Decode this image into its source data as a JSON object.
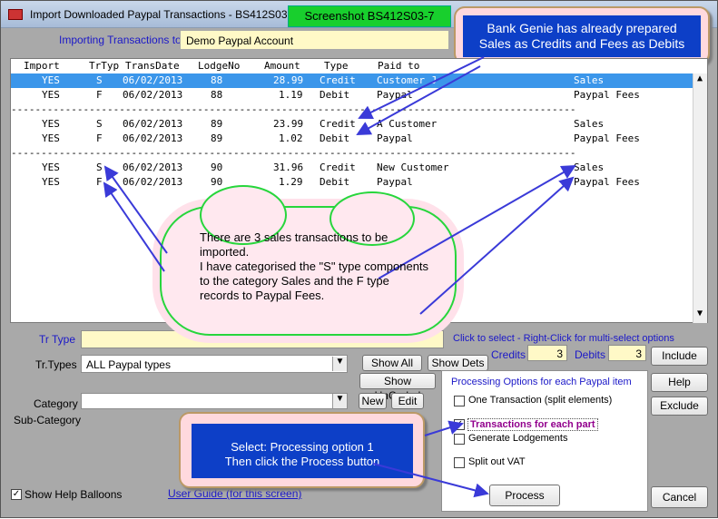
{
  "window": {
    "title": "Import Downloaded Paypal Transactions - BS412S03",
    "screenshot_label": "Screenshot BS412S03-7"
  },
  "callouts": {
    "top": "Bank Genie has already prepared\nSales as Credits and Fees as Debits",
    "cloud": "There are 3 sales transactions to be imported.\nI have categorised the \"S\" type components to the category Sales and the F type records to Paypal Fees.",
    "bottom": "Select: Processing option 1\nThen click the Process button"
  },
  "importing": {
    "label": "Importing Transactions to",
    "value": "Demo Paypal Account"
  },
  "columns": [
    "Import",
    "TrTyp",
    "TransDate",
    "LodgeNo",
    "Amount",
    "Type",
    "Paid to"
  ],
  "rows": [
    {
      "import": "YES",
      "trtyp": "S",
      "date": "06/02/2013",
      "lodge": "88",
      "amount": "28.99",
      "type": "Credit",
      "paid_to": "Customer J",
      "category": "Sales"
    },
    {
      "import": "YES",
      "trtyp": "F",
      "date": "06/02/2013",
      "lodge": "88",
      "amount": "1.19",
      "type": "Debit",
      "paid_to": "Paypal",
      "category": "Paypal Fees"
    },
    {
      "import": "YES",
      "trtyp": "S",
      "date": "06/02/2013",
      "lodge": "89",
      "amount": "23.99",
      "type": "Credit",
      "paid_to": "A Customer",
      "category": "Sales"
    },
    {
      "import": "YES",
      "trtyp": "F",
      "date": "06/02/2013",
      "lodge": "89",
      "amount": "1.02",
      "type": "Debit",
      "paid_to": "Paypal",
      "category": "Paypal Fees"
    },
    {
      "import": "YES",
      "trtyp": "S",
      "date": "06/02/2013",
      "lodge": "90",
      "amount": "31.96",
      "type": "Credit",
      "paid_to": "New Customer",
      "category": "Sales"
    },
    {
      "import": "YES",
      "trtyp": "F",
      "date": "06/02/2013",
      "lodge": "90",
      "amount": "1.29",
      "type": "Debit",
      "paid_to": "Paypal",
      "category": "Paypal Fees"
    }
  ],
  "separator": "----------------------------------------------------------------------------------------------",
  "filters": {
    "tr_type_label": "Tr Type",
    "tr_types_label": "Tr.Types",
    "tr_types_value": "ALL Paypal types",
    "category_label": "Category",
    "sub_category_label": "Sub-Category"
  },
  "buttons": {
    "show_all": "Show All",
    "show_dets": "Show Dets",
    "show_uncoded": "Show UnCoded",
    "new": "New",
    "edit": "Edit",
    "include": "Include",
    "help": "Help",
    "exclude": "Exclude",
    "process": "Process",
    "cancel": "Cancel"
  },
  "counts": {
    "hint": "Click to select  -  Right-Click for multi-select options",
    "credits_label": "Credits",
    "credits": "3",
    "debits_label": "Debits",
    "debits": "3"
  },
  "processing": {
    "title": "Processing Options for each Paypal  item",
    "one_transaction": "One Transaction (split elements)",
    "each_part": "Transactions for each part",
    "generate_lodgements": "Generate Lodgements",
    "split_vat": "Split out VAT"
  },
  "bottom": {
    "help_balloons": "Show Help Balloons",
    "user_guide": "User Guide (for this screen)"
  }
}
